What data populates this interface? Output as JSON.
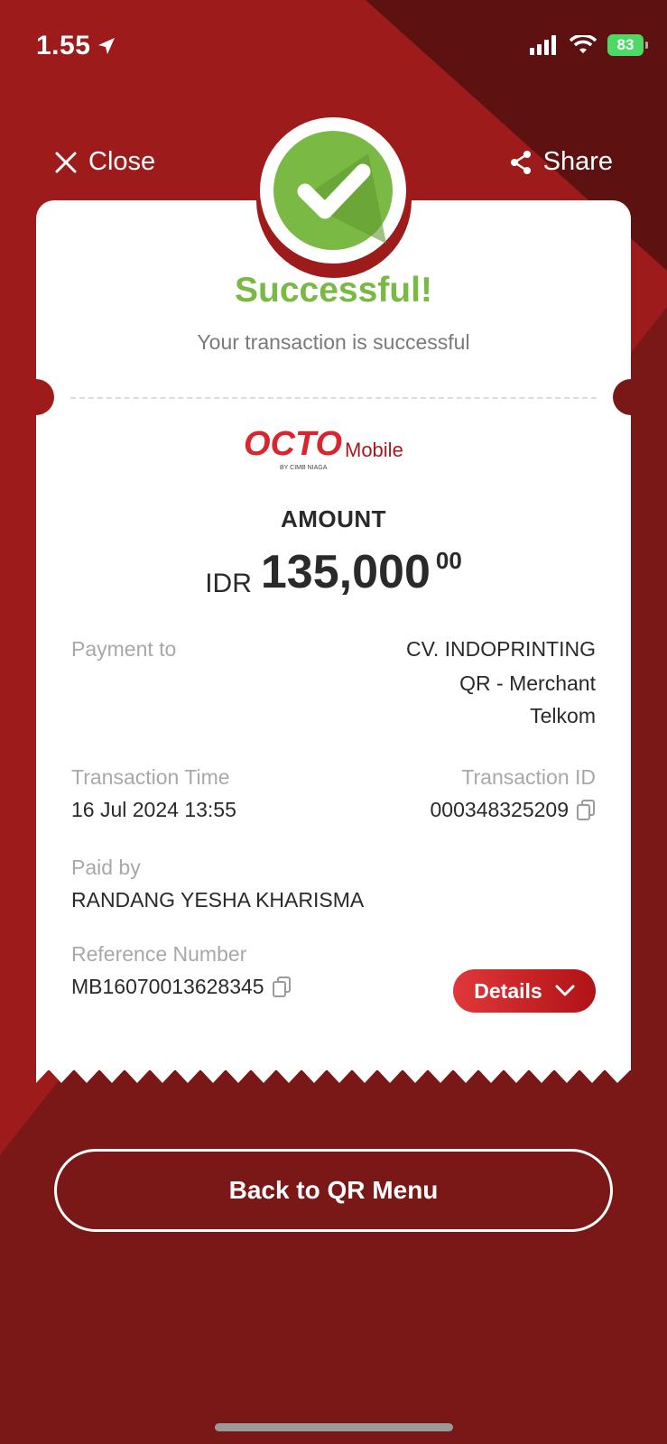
{
  "status_bar": {
    "time": "1.55",
    "battery": "83"
  },
  "header": {
    "close_label": "Close",
    "share_label": "Share"
  },
  "receipt": {
    "title": "Successful!",
    "subtitle": "Your transaction is successful",
    "logo": {
      "brand": "OCTO",
      "product": "Mobile",
      "byline": "BY CIMB NIAGA"
    },
    "amount_label": "AMOUNT",
    "amount": {
      "currency": "IDR",
      "value": "135,000",
      "decimals": "00"
    },
    "payment_to": {
      "label": "Payment to",
      "line1": "CV. INDOPRINTING",
      "line2": "QR - Merchant",
      "line3": "Telkom"
    },
    "transaction_time": {
      "label": "Transaction Time",
      "value": "16 Jul 2024 13:55"
    },
    "transaction_id": {
      "label": "Transaction ID",
      "value": "000348325209"
    },
    "paid_by": {
      "label": "Paid by",
      "value": "RANDANG YESHA KHARISMA"
    },
    "reference": {
      "label": "Reference Number",
      "value": "MB16070013628345"
    },
    "details_label": "Details"
  },
  "footer": {
    "back_label": "Back to QR Menu"
  },
  "colors": {
    "primary_red": "#9d1b1b",
    "dark_red": "#7a1717",
    "success_green": "#7ab943"
  }
}
